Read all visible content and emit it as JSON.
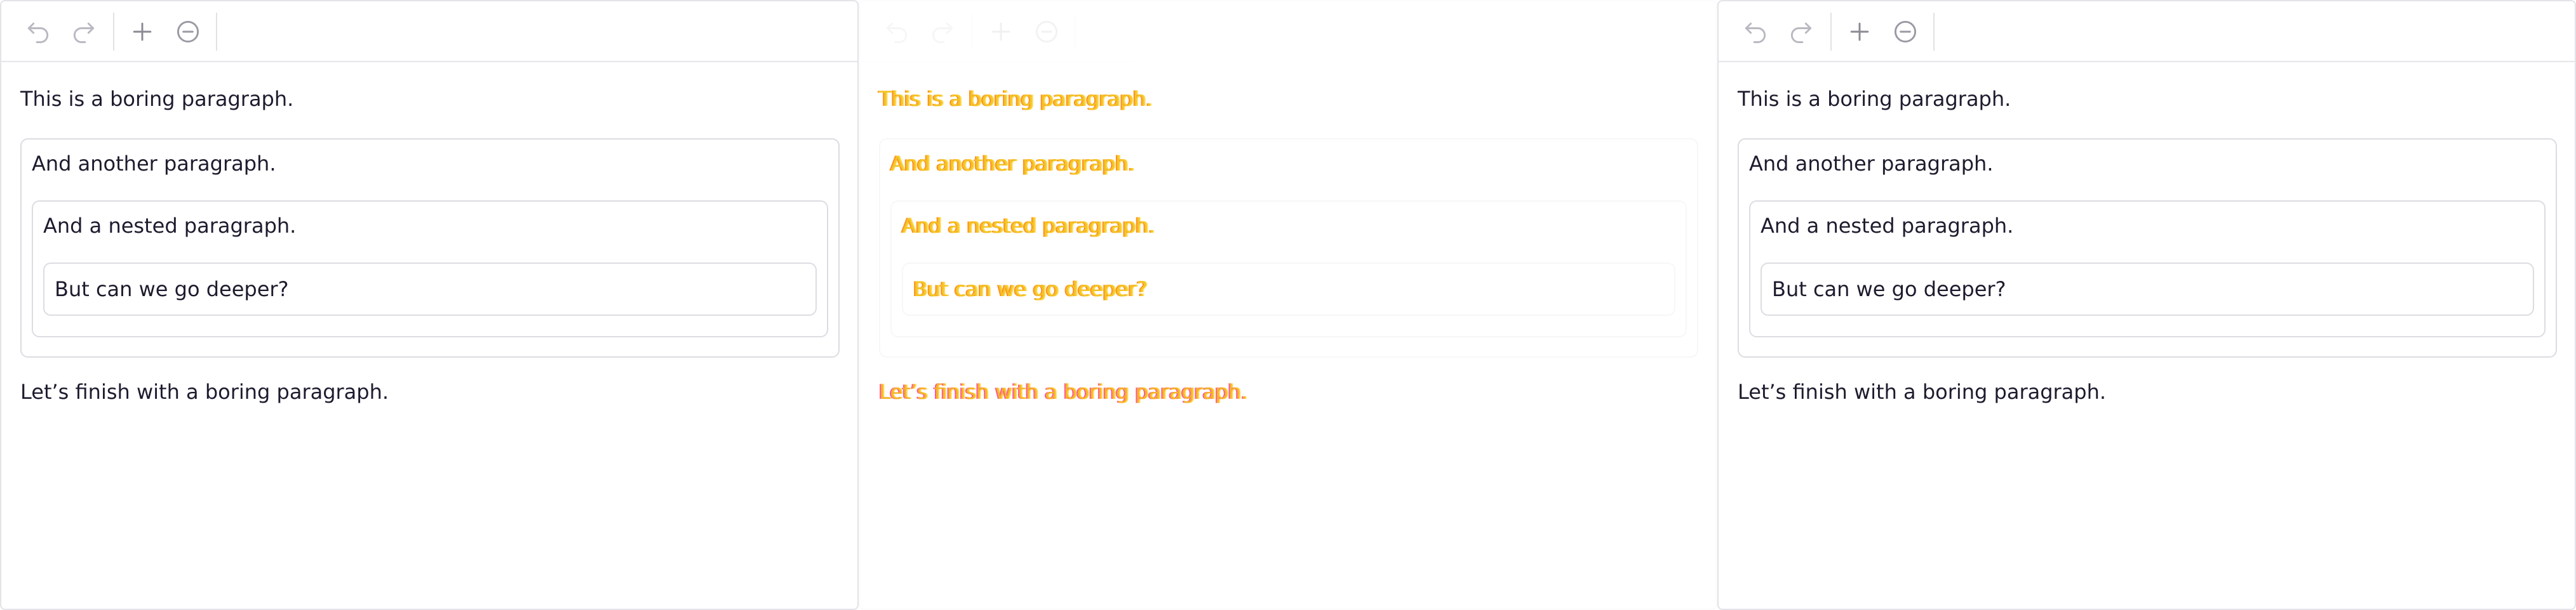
{
  "toolbar": {
    "undo_icon": "undo-icon",
    "redo_icon": "redo-icon",
    "add_icon": "plus-icon",
    "remove_icon": "minus-circle-icon"
  },
  "editor_left": {
    "p1": "This is a boring paragraph.",
    "p2": "And another paragraph.",
    "p3": "And a nested paragraph.",
    "p4": "But can we go deeper?",
    "p5": "Let’s finish with a boring paragraph."
  },
  "editor_middle": {
    "p1": "This is a boring paragraph.",
    "p2": "And another paragraph.",
    "p3": "And a nested paragraph.",
    "p4": "But can we go deeper?",
    "p5": "Let’s finish with a boring paragraph."
  },
  "editor_right": {
    "p1": "This is a boring paragraph.",
    "p2": "And another paragraph.",
    "p3": "And a nested paragraph.",
    "p4": "But can we go deeper?",
    "p5": "Let’s finish with a boring paragraph."
  },
  "colors": {
    "text": "#1d1c2e",
    "border": "#dcdce2",
    "icon": "#b9b9c2",
    "highlight_yellow": "#f3c21a",
    "highlight_orange": "#ff8a1a"
  }
}
